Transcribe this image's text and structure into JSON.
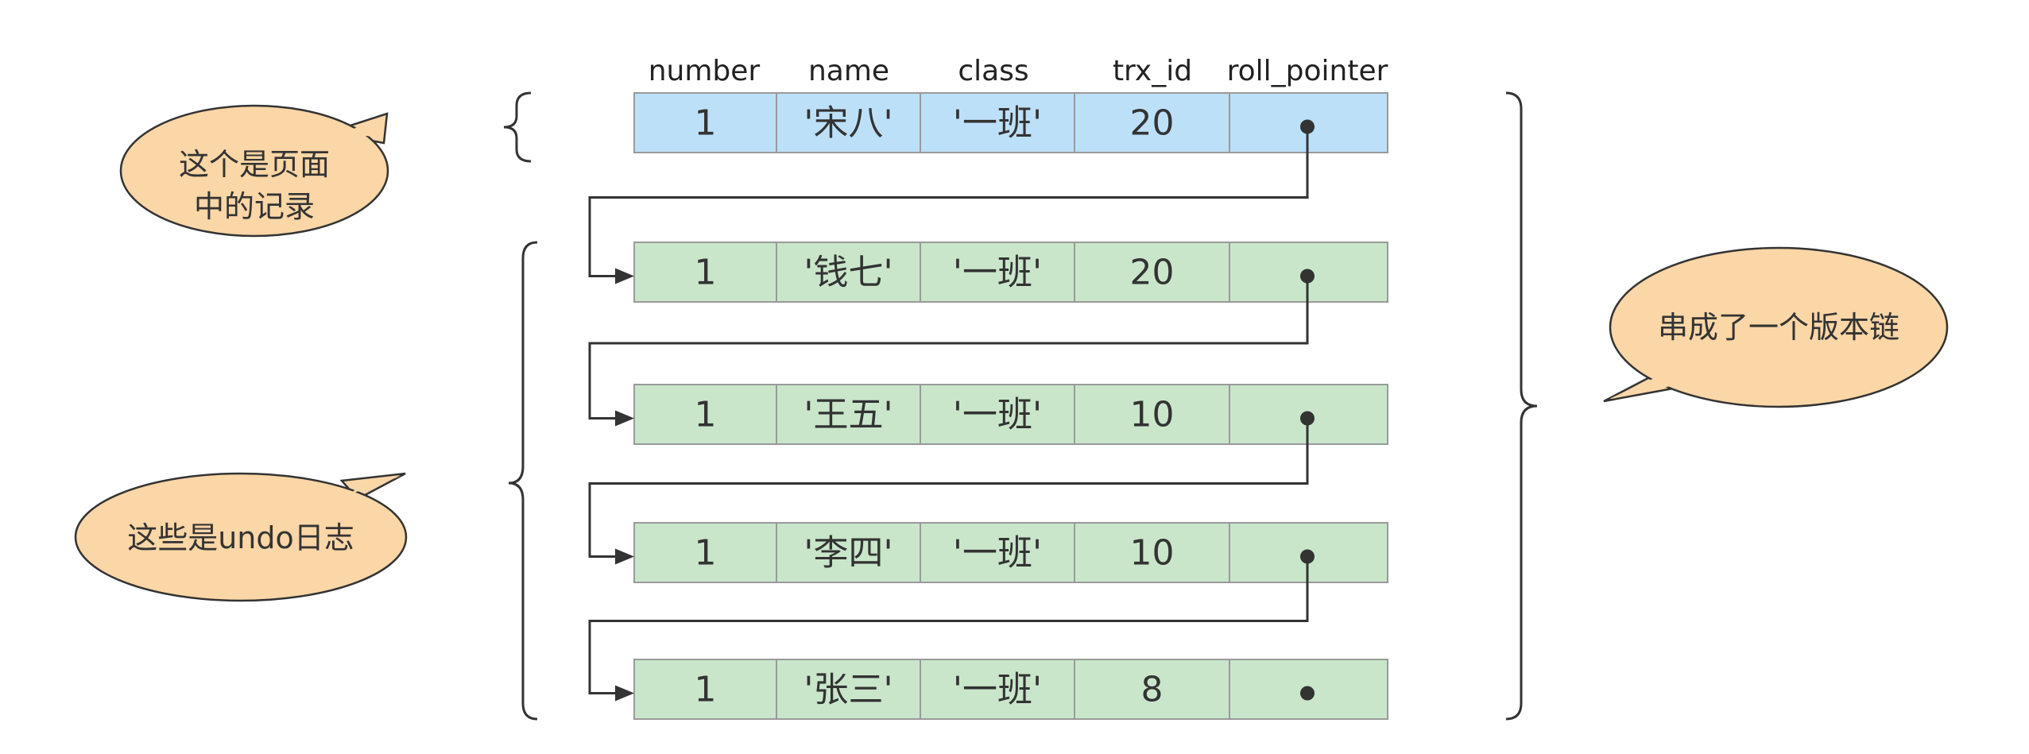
{
  "headers": [
    "number",
    "name",
    "class",
    "trx_id",
    "roll_pointer"
  ],
  "rows": [
    {
      "kind": "page-record",
      "cells": [
        "1",
        "'宋八'",
        "'一班'",
        "20"
      ]
    },
    {
      "kind": "undo-log",
      "cells": [
        "1",
        "'钱七'",
        "'一班'",
        "20"
      ]
    },
    {
      "kind": "undo-log",
      "cells": [
        "1",
        "'王五'",
        "'一班'",
        "10"
      ]
    },
    {
      "kind": "undo-log",
      "cells": [
        "1",
        "'李四'",
        "'一班'",
        "10"
      ]
    },
    {
      "kind": "undo-log",
      "cells": [
        "1",
        "'张三'",
        "'一班'",
        "8"
      ]
    }
  ],
  "bubbles": {
    "page_record": [
      "这个是页面",
      "中的记录"
    ],
    "undo_log": [
      "这些是undo日志"
    ],
    "version_chain": [
      "串成了一个版本链"
    ]
  },
  "colors": {
    "page_record_fill": "#bde0f9",
    "undo_log_fill": "#c9e6cb",
    "bubble_fill": "#fbd6a6",
    "line": "#333333"
  }
}
